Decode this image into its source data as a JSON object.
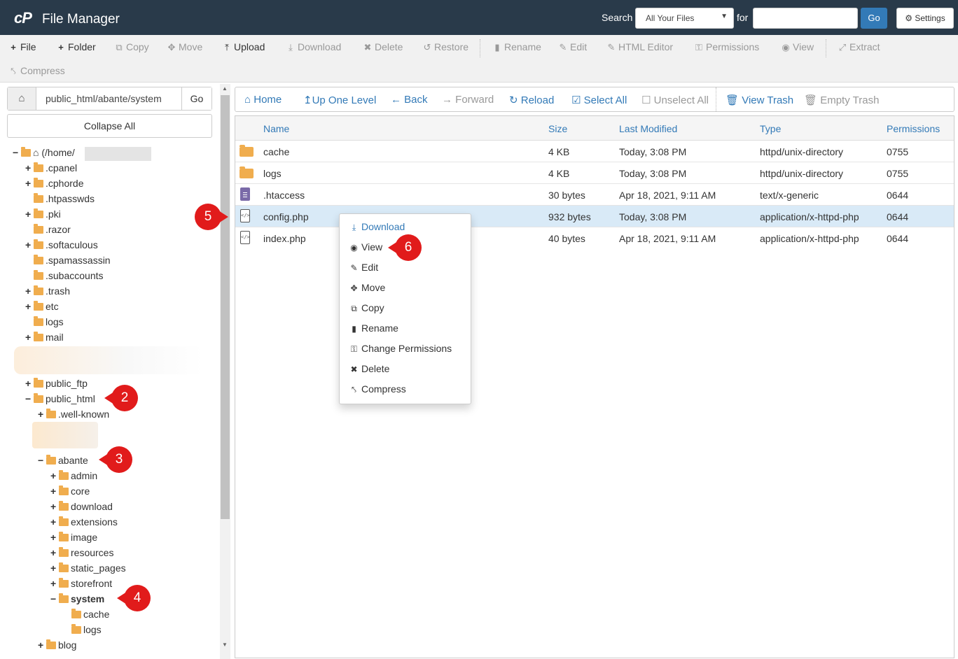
{
  "header": {
    "logo": "cP",
    "title": "File Manager",
    "search_label": "Search",
    "search_scope": "All Your Files",
    "for_label": "for",
    "search_placeholder": "",
    "go": "Go",
    "settings": "Settings"
  },
  "toolbar": {
    "file": "File",
    "folder": "Folder",
    "copy": "Copy",
    "move": "Move",
    "upload": "Upload",
    "download": "Download",
    "delete": "Delete",
    "restore": "Restore",
    "rename": "Rename",
    "edit": "Edit",
    "html_editor": "HTML Editor",
    "permissions": "Permissions",
    "view": "View",
    "extract": "Extract",
    "compress": "Compress"
  },
  "sidebar": {
    "path": "public_html/abante/system",
    "go": "Go",
    "collapse_all": "Collapse All",
    "root": "(/home/",
    "items": [
      ".cpanel",
      ".cphorde",
      ".htpasswds",
      ".pki",
      ".razor",
      ".softaculous",
      ".spamassassin",
      ".subaccounts",
      ".trash",
      "etc",
      "logs",
      "mail",
      "public_ftp",
      "public_html",
      ".well-known",
      "abante",
      "admin",
      "core",
      "download",
      "extensions",
      "image",
      "resources",
      "static_pages",
      "storefront",
      "system",
      "cache",
      "logs",
      "blog"
    ]
  },
  "navbar": {
    "home": "Home",
    "up": "Up One Level",
    "back": "Back",
    "forward": "Forward",
    "reload": "Reload",
    "select_all": "Select All",
    "unselect_all": "Unselect All",
    "view_trash": "View Trash",
    "empty_trash": "Empty Trash"
  },
  "table": {
    "columns": [
      "Name",
      "Size",
      "Last Modified",
      "Type",
      "Permissions"
    ],
    "rows": [
      {
        "name": "cache",
        "size": "4 KB",
        "modified": "Today, 3:08 PM",
        "type": "httpd/unix-directory",
        "perm": "0755"
      },
      {
        "name": "logs",
        "size": "4 KB",
        "modified": "Today, 3:08 PM",
        "type": "httpd/unix-directory",
        "perm": "0755"
      },
      {
        "name": ".htaccess",
        "size": "30 bytes",
        "modified": "Apr 18, 2021, 9:11 AM",
        "type": "text/x-generic",
        "perm": "0644"
      },
      {
        "name": "config.php",
        "size": "932 bytes",
        "modified": "Today, 3:08 PM",
        "type": "application/x-httpd-php",
        "perm": "0644"
      },
      {
        "name": "index.php",
        "size": "40 bytes",
        "modified": "Apr 18, 2021, 9:11 AM",
        "type": "application/x-httpd-php",
        "perm": "0644"
      }
    ]
  },
  "context_menu": {
    "items": [
      "Download",
      "View",
      "Edit",
      "Move",
      "Copy",
      "Rename",
      "Change Permissions",
      "Delete",
      "Compress"
    ]
  },
  "annotations": [
    "2",
    "3",
    "4",
    "5",
    "6"
  ],
  "colors": {
    "header_bg": "#293a4a",
    "accent": "#337ab7",
    "folder": "#f0ad4e",
    "badge": "#e11b1b",
    "selected_row": "#d9eaf7"
  }
}
